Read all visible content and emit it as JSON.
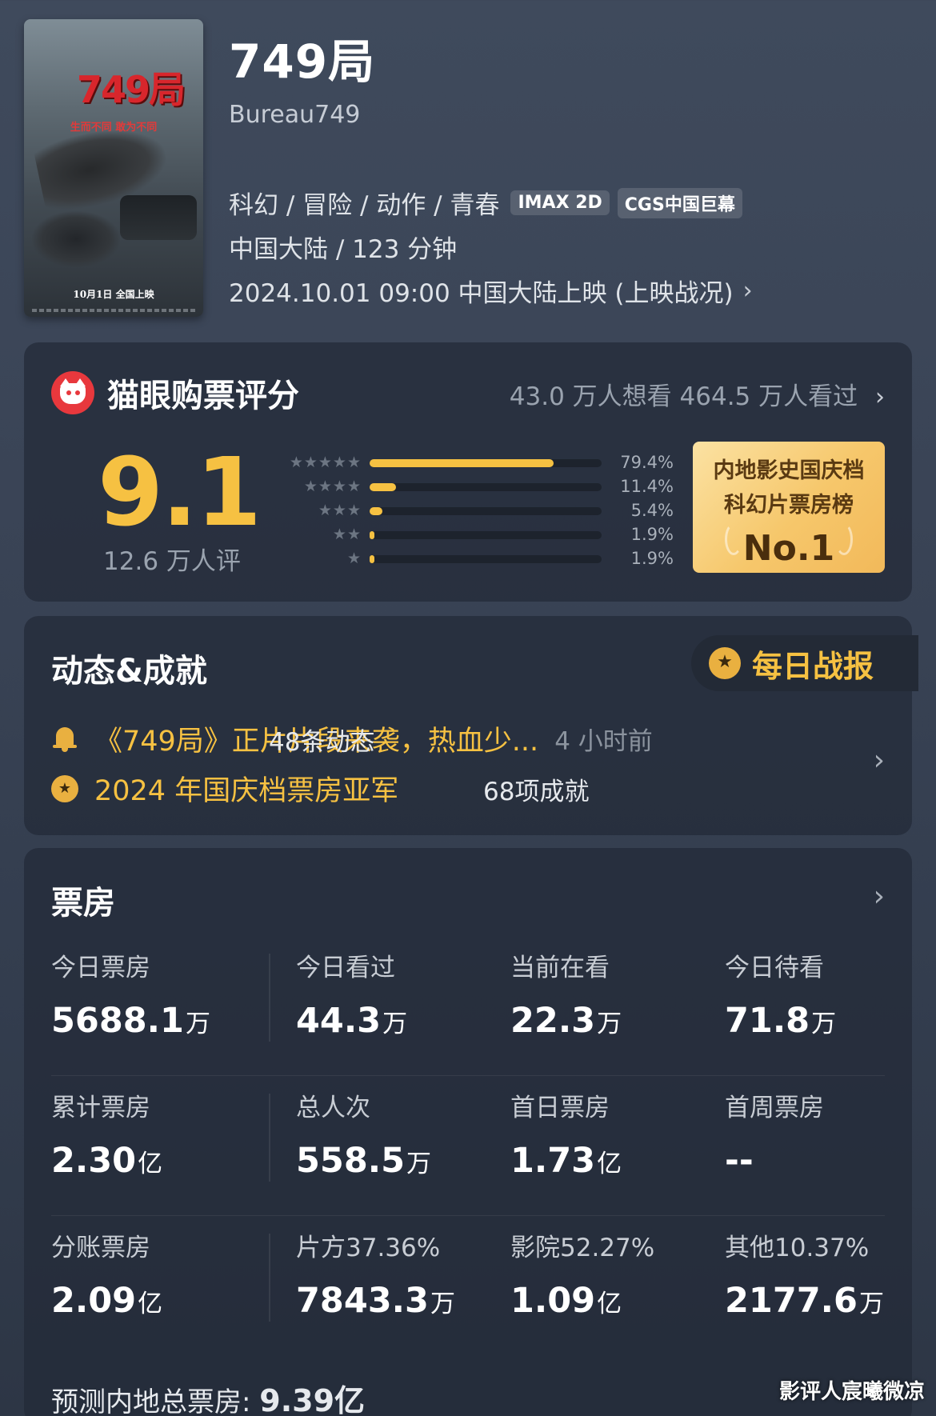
{
  "movie": {
    "title": "749局",
    "english_title": "Bureau749",
    "genres": "科幻 / 冒险 / 动作 / 青春",
    "badges": [
      "IMAX 2D",
      "CGS中国巨幕"
    ],
    "region_duration": "中国大陆 / 123 分钟",
    "release": "2024.10.01 09:00 中国大陆上映 (上映战况)",
    "poster": {
      "logo": "749局",
      "tagline": "生而不同 敢为不同",
      "date": "10月1日 全国上映"
    }
  },
  "rating": {
    "title": "猫眼购票评分",
    "stats": "43.0 万人想看  464.5 万人看过",
    "score": "9.1",
    "count": "12.6 万人评",
    "distribution": [
      {
        "stars": "★★★★★",
        "percent": 79.4,
        "label": "79.4%"
      },
      {
        "stars": "★★★★",
        "percent": 11.4,
        "label": "11.4%"
      },
      {
        "stars": "★★★",
        "percent": 5.4,
        "label": "5.4%"
      },
      {
        "stars": "★★",
        "percent": 1.9,
        "label": "1.9%"
      },
      {
        "stars": "★",
        "percent": 1.9,
        "label": "1.9%"
      }
    ],
    "rank": {
      "line1": "内地影史国庆档",
      "line2": "科幻片票房榜",
      "line3": "No.1"
    }
  },
  "dynamics": {
    "title": "动态&成就",
    "daily_report": "每日战报",
    "news": "《749局》正片片段来袭，热血少...",
    "news_time": "4 小时前",
    "achievement": "2024 年国庆档票房亚军",
    "news_count": "48条动态",
    "achievement_count": "68项成就"
  },
  "box_office": {
    "title": "票房",
    "rows": [
      [
        {
          "label": "今日票房",
          "value": "5688.1",
          "unit": "万"
        },
        {
          "label": "今日看过",
          "value": "44.3",
          "unit": "万"
        },
        {
          "label": "当前在看",
          "value": "22.3",
          "unit": "万"
        },
        {
          "label": "今日待看",
          "value": "71.8",
          "unit": "万"
        }
      ],
      [
        {
          "label": "累计票房",
          "value": "2.30",
          "unit": "亿"
        },
        {
          "label": "总人次",
          "value": "558.5",
          "unit": "万"
        },
        {
          "label": "首日票房",
          "value": "1.73",
          "unit": "亿"
        },
        {
          "label": "首周票房",
          "value": "--",
          "unit": ""
        }
      ],
      [
        {
          "label": "分账票房",
          "value": "2.09",
          "unit": "亿"
        },
        {
          "label": "片方37.36%",
          "value": "7843.3",
          "unit": "万"
        },
        {
          "label": "影院52.27%",
          "value": "1.09",
          "unit": "亿"
        },
        {
          "label": "其他10.37%",
          "value": "2177.6",
          "unit": "万"
        }
      ]
    ],
    "prediction_label": "预测内地总票房:",
    "prediction_value": "9.39亿"
  },
  "watermark": "影评人宸曦微凉"
}
